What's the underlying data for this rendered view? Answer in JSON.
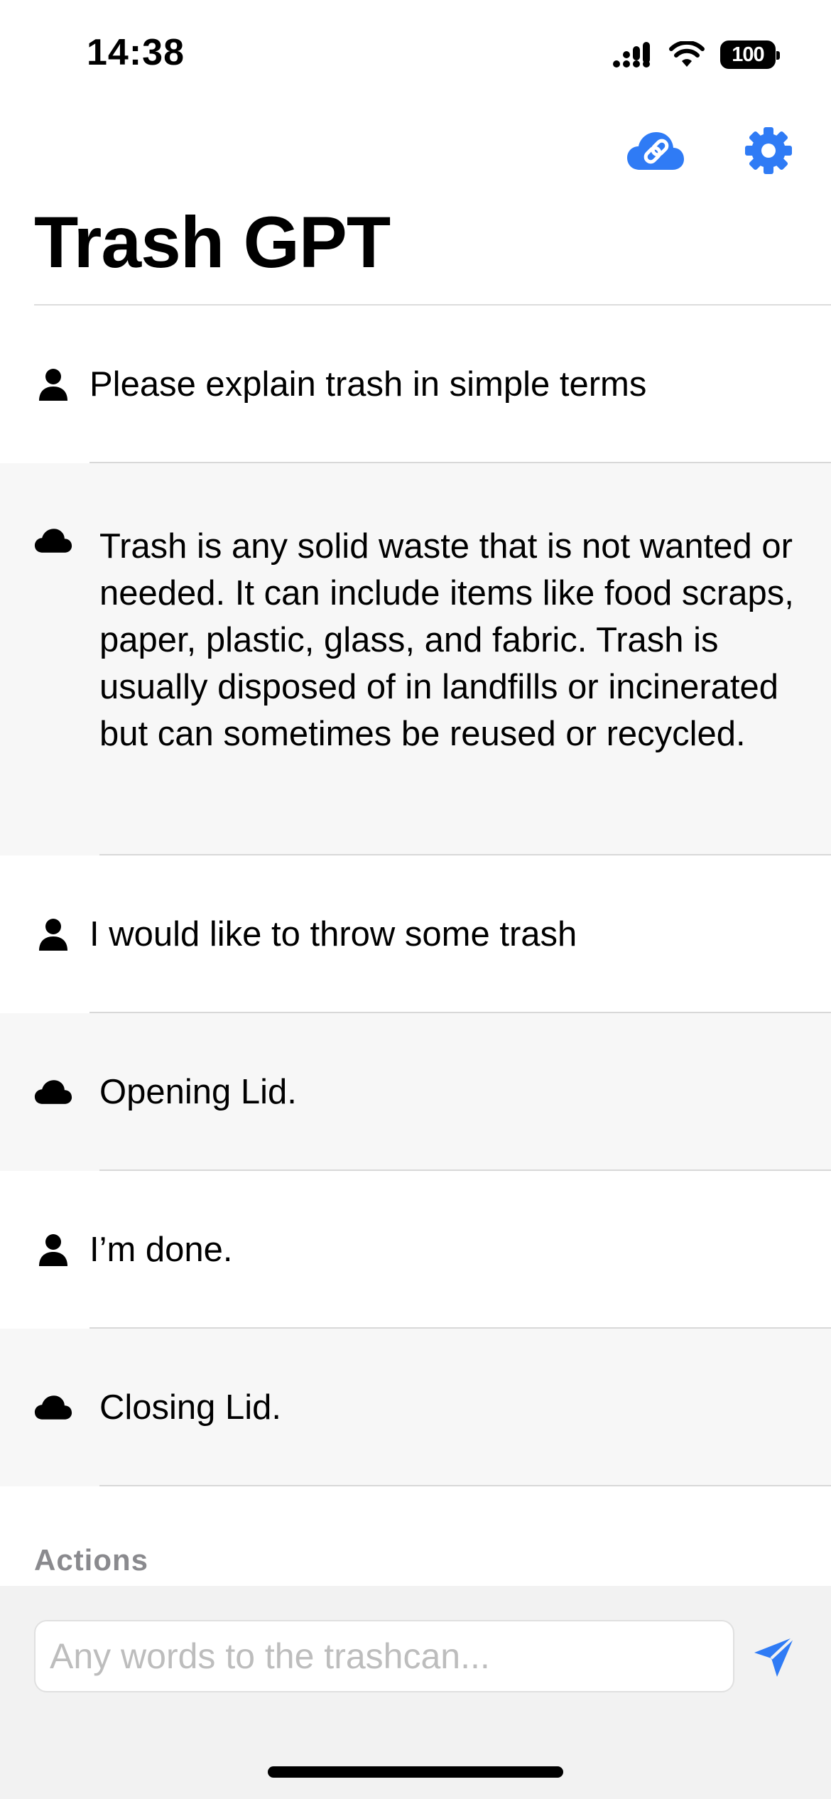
{
  "status_bar": {
    "time": "14:38",
    "battery": "100"
  },
  "header": {
    "title": "Trash GPT",
    "icons": {
      "connect": "cloud-link-icon",
      "settings": "gear-icon"
    },
    "accent_color": "#2f7bf5"
  },
  "messages": [
    {
      "role": "user",
      "icon": "person-icon",
      "text": "Please explain trash in simple terms"
    },
    {
      "role": "assistant",
      "icon": "cloud-icon",
      "text": "Trash is any solid waste that is not wanted or needed. It can include items like food scraps, paper, plastic, glass, and fabric. Trash is usually disposed of in landfills or incinerated but can sometimes be reused or recycled."
    },
    {
      "role": "user",
      "icon": "person-icon",
      "text": "I would like to throw some trash"
    },
    {
      "role": "assistant",
      "icon": "cloud-icon",
      "text": "Opening Lid."
    },
    {
      "role": "user",
      "icon": "person-icon",
      "text": "I’m done."
    },
    {
      "role": "assistant",
      "icon": "cloud-icon",
      "text": "Closing Lid."
    }
  ],
  "actions": {
    "label": "Actions"
  },
  "composer": {
    "placeholder": "Any words to the trashcan...",
    "value": "",
    "send_icon": "send-icon"
  }
}
